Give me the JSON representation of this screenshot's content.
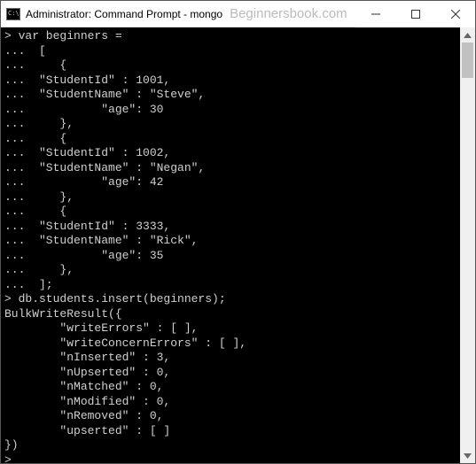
{
  "titlebar": {
    "title": "Administrator: Command Prompt - mongo",
    "watermark": "Beginnersbook.com"
  },
  "terminal": {
    "lines": [
      "> var beginners =",
      "...  [",
      "...     {",
      "...  \"StudentId\" : 1001,",
      "...  \"StudentName\" : \"Steve\",",
      "...           \"age\": 30",
      "...     },",
      "...     {",
      "...  \"StudentId\" : 1002,",
      "...  \"StudentName\" : \"Negan\",",
      "...           \"age\": 42",
      "...     },",
      "...     {",
      "...  \"StudentId\" : 3333,",
      "...  \"StudentName\" : \"Rick\",",
      "...           \"age\": 35",
      "...     },",
      "...  ];",
      "> db.students.insert(beginners);",
      "BulkWriteResult({",
      "        \"writeErrors\" : [ ],",
      "        \"writeConcernErrors\" : [ ],",
      "        \"nInserted\" : 3,",
      "        \"nUpserted\" : 0,",
      "        \"nMatched\" : 0,",
      "        \"nModified\" : 0,",
      "        \"nRemoved\" : 0,",
      "        \"upserted\" : [ ]",
      "})",
      ">"
    ]
  }
}
